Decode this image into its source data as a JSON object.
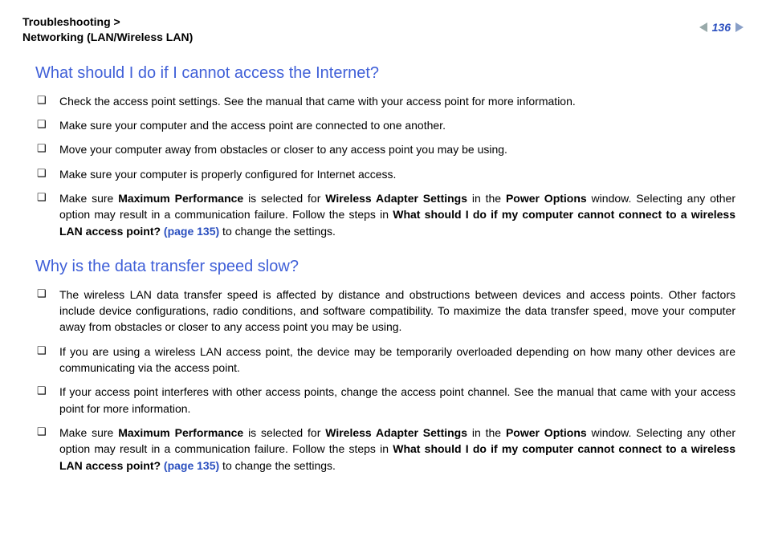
{
  "header": {
    "breadcrumb_section": "Troubleshooting >",
    "breadcrumb_page": "Networking (LAN/Wireless LAN)",
    "page_number": "136"
  },
  "section1": {
    "heading": "What should I do if I cannot access the Internet?",
    "items": {
      "i0": "Check the access point settings. See the manual that came with your access point for more information.",
      "i1": "Make sure your computer and the access point are connected to one another.",
      "i2": "Move your computer away from obstacles or closer to any access point you may be using.",
      "i3": "Make sure your computer is properly configured for Internet access.",
      "i4": {
        "t0": "Make sure ",
        "b0": "Maximum Performance",
        "t1": " is selected for ",
        "b1": "Wireless Adapter Settings",
        "t2": " in the ",
        "b2": "Power Options",
        "t3": " window. Selecting any other option may result in a communication failure. Follow the steps in ",
        "b3": "What should I do if my computer cannot connect to a wireless LAN access point? ",
        "link": "(page 135)",
        "t4": " to change the settings."
      }
    }
  },
  "section2": {
    "heading": "Why is the data transfer speed slow?",
    "items": {
      "i0": "The wireless LAN data transfer speed is affected by distance and obstructions between devices and access points. Other factors include device configurations, radio conditions, and software compatibility. To maximize the data transfer speed, move your computer away from obstacles or closer to any access point you may be using.",
      "i1": "If you are using a wireless LAN access point, the device may be temporarily overloaded depending on how many other devices are communicating via the access point.",
      "i2": "If your access point interferes with other access points, change the access point channel. See the manual that came with your access point for more information.",
      "i3": {
        "t0": "Make sure ",
        "b0": "Maximum Performance",
        "t1": " is selected for ",
        "b1": "Wireless Adapter Settings",
        "t2": " in the ",
        "b2": "Power Options",
        "t3": " window. Selecting any other option may result in a communication failure. Follow the steps in ",
        "b3": "What should I do if my computer cannot connect to a wireless LAN access point? ",
        "link": "(page 135)",
        "t4": " to change the settings."
      }
    }
  }
}
